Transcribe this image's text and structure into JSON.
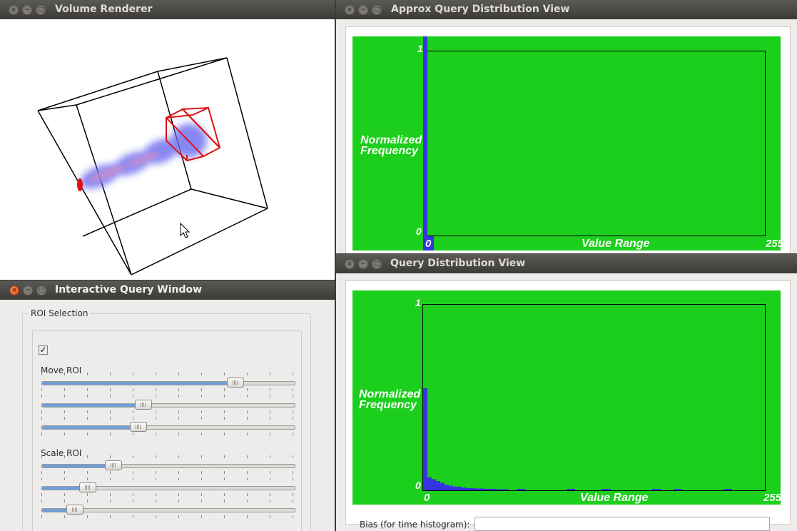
{
  "volume_renderer": {
    "title": "Volume Renderer"
  },
  "approx_view": {
    "title": "Approx Query Distribution View",
    "y_label_line1": "Normalized",
    "y_label_line2": "Frequency",
    "x_label": "Value Range",
    "y_max": "1",
    "y_min": "0",
    "x_min": "0",
    "x_max": "255"
  },
  "query_view": {
    "title": "Query Distribution View",
    "y_label_line1": "Normalized",
    "y_label_line2": "Frequency",
    "x_label": "Value Range",
    "y_max": "1",
    "y_min": "0",
    "x_min": "0",
    "x_max": "255",
    "bias_label": "Bias (for time histogram):",
    "bias_value": ""
  },
  "query_window": {
    "title": "Interactive Query Window",
    "roi_group": "ROI Selection",
    "enabled": true,
    "move_label": "Move ROI",
    "scale_label": "Scale ROI",
    "move_sliders": [
      0.76,
      0.4,
      0.38
    ],
    "scale_sliders": [
      0.28,
      0.18,
      0.13
    ]
  },
  "chart_data": [
    {
      "type": "bar",
      "x_range": [
        0,
        255
      ],
      "y_range": [
        0,
        1
      ],
      "values_at_bins": [
        1.0,
        0.0
      ],
      "note_bins": "single bar at value 0"
    },
    {
      "type": "bar",
      "x_range": [
        0,
        255
      ],
      "y_range": [
        0,
        1
      ],
      "values": [
        0.55,
        0.07,
        0.06,
        0.05,
        0.04,
        0.03,
        0.025,
        0.02,
        0.02,
        0.015,
        0.012,
        0.012,
        0.01,
        0.01,
        0.008,
        0.008,
        0.008,
        0.006,
        0.006,
        0.006
      ]
    }
  ],
  "colors": {
    "plot_bg": "#1ccf1c",
    "bar": "#3434e0",
    "roi_box": "#e01010"
  }
}
